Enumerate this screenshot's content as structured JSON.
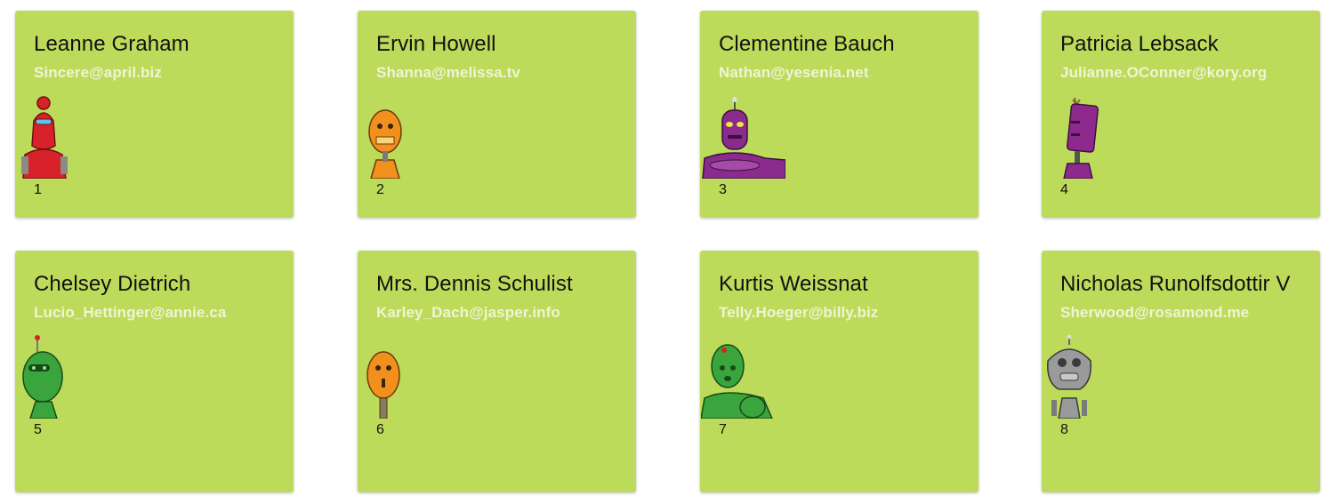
{
  "users": [
    {
      "name": "Leanne Graham",
      "email": "Sincere@april.biz",
      "id": "1",
      "robot_color": "#d8222a",
      "robot_icon": "robot-red-icon"
    },
    {
      "name": "Ervin Howell",
      "email": "Shanna@melissa.tv",
      "id": "2",
      "robot_color": "#f2901e",
      "robot_icon": "robot-orange-icon"
    },
    {
      "name": "Clementine Bauch",
      "email": "Nathan@yesenia.net",
      "id": "3",
      "robot_color": "#8a2b8e",
      "robot_icon": "robot-purple-icon"
    },
    {
      "name": "Patricia Lebsack",
      "email": "Julianne.OConner@kory.org",
      "id": "4",
      "robot_color": "#8e2a8e",
      "robot_icon": "robot-purple-icon"
    },
    {
      "name": "Chelsey Dietrich",
      "email": "Lucio_Hettinger@annie.ca",
      "id": "5",
      "robot_color": "#3aa53c",
      "robot_icon": "robot-green-icon"
    },
    {
      "name": "Mrs. Dennis Schulist",
      "email": "Karley_Dach@jasper.info",
      "id": "6",
      "robot_color": "#f2901e",
      "robot_icon": "robot-orange-icon"
    },
    {
      "name": "Kurtis Weissnat",
      "email": "Telly.Hoeger@billy.biz",
      "id": "7",
      "robot_color": "#3aa53c",
      "robot_icon": "robot-green-icon"
    },
    {
      "name": "Nicholas Runolfsdottir V",
      "email": "Sherwood@rosamond.me",
      "id": "8",
      "robot_color": "#9a9a9a",
      "robot_icon": "robot-grey-icon"
    }
  ],
  "colors": {
    "card_bg": "#bddb5a",
    "email_text": "#eef4d6",
    "name_text": "#111111"
  }
}
